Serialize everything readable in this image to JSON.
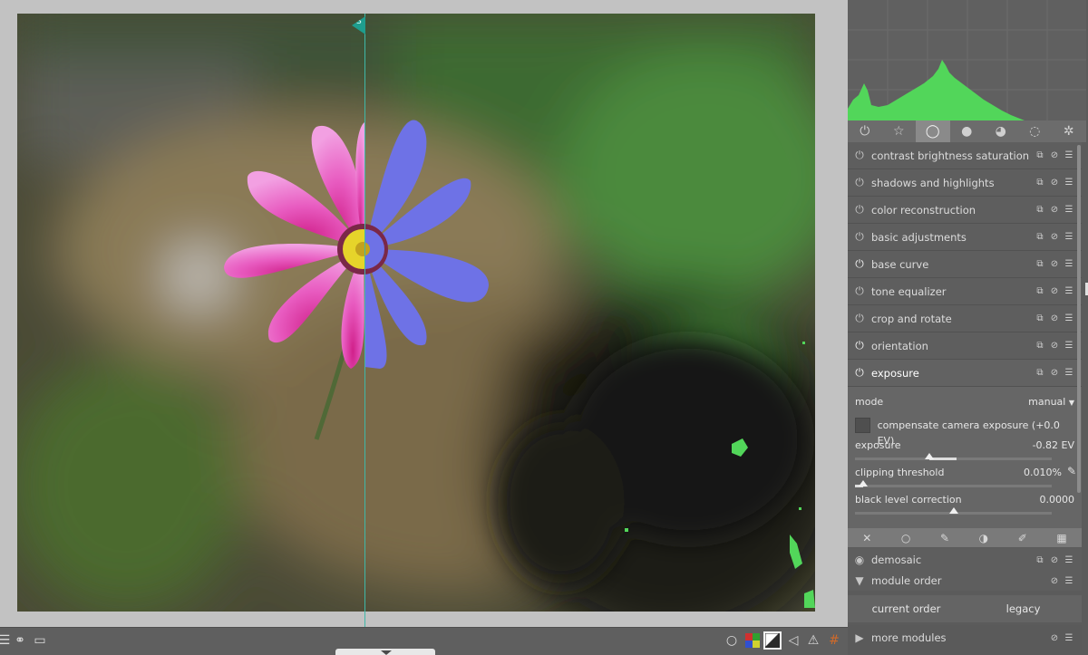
{
  "split_marker_label": "S",
  "right_panel": {
    "module_tabs": [
      {
        "icon": "power-icon",
        "glyph": "⏻"
      },
      {
        "icon": "star-icon",
        "glyph": "☆"
      },
      {
        "icon": "circle-icon",
        "glyph": "◯"
      },
      {
        "icon": "gradient-sphere-icon",
        "glyph": "●"
      },
      {
        "icon": "color-wheel-icon",
        "glyph": "◕"
      },
      {
        "icon": "correct-icon",
        "glyph": "◌"
      },
      {
        "icon": "effects-icon",
        "glyph": "✲"
      }
    ],
    "modules": [
      {
        "label": "contrast brightness saturation",
        "on": false
      },
      {
        "label": "shadows and highlights",
        "on": false
      },
      {
        "label": "color reconstruction",
        "on": false
      },
      {
        "label": "basic adjustments",
        "on": false
      },
      {
        "label": "base curve",
        "on": true
      },
      {
        "label": "tone equalizer",
        "on": false
      },
      {
        "label": "crop and rotate",
        "on": false
      },
      {
        "label": "orientation",
        "on": true
      },
      {
        "label": "exposure",
        "on": true
      }
    ],
    "exposure": {
      "mode_label": "mode",
      "mode_value": "manual",
      "compensate_label": "compensate camera exposure (+0.0 EV)",
      "exposure_label": "exposure",
      "exposure_value": "-0.82 EV",
      "exposure_fraction": 0.38,
      "clipping_label": "clipping threshold",
      "clipping_value": "0.010%",
      "clipping_fraction": 0.04,
      "black_label": "black level correction",
      "black_value": "0.0000",
      "black_fraction": 0.5
    },
    "demosaic_label": "demosaic",
    "module_order_label": "module order",
    "current_order_label": "current order",
    "legacy_label": "legacy",
    "more_modules_label": "more modules"
  },
  "accent_colors": {
    "histogram": "#52d65a",
    "overexposure": "#6e72e6",
    "split_line": "#3fb8a8"
  }
}
